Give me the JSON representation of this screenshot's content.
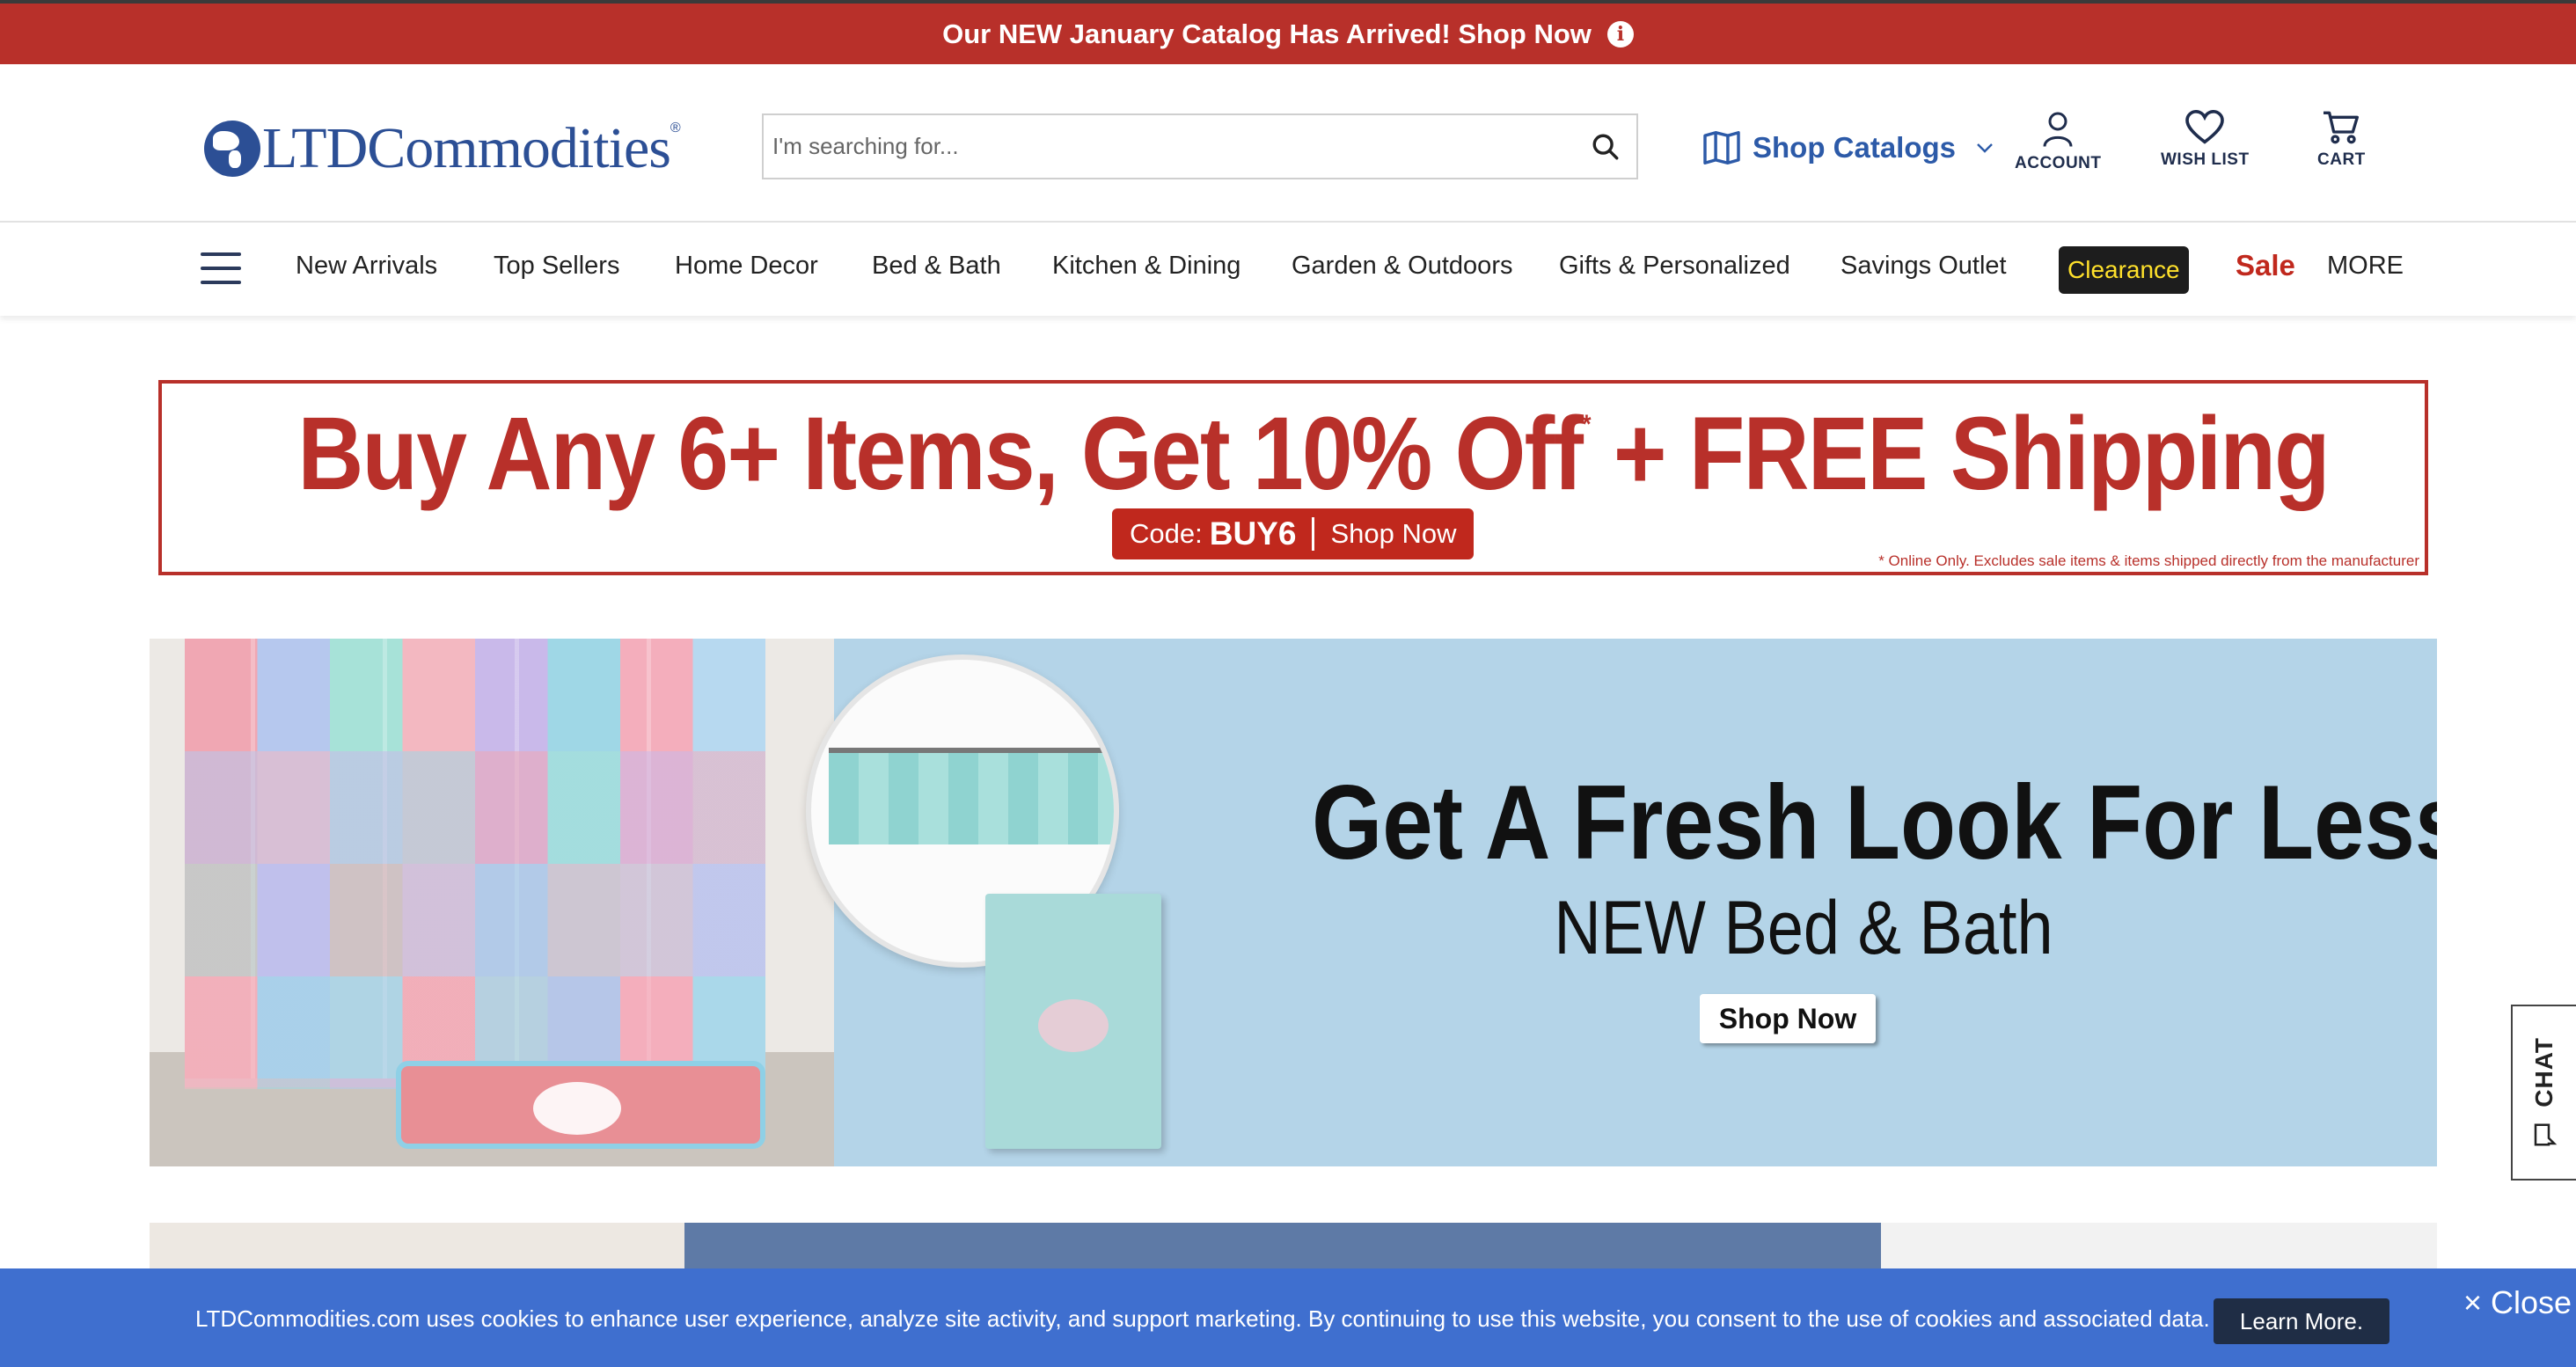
{
  "announcement": {
    "text": "Our NEW January Catalog Has Arrived! Shop Now",
    "icon": "info-icon"
  },
  "header": {
    "logo_text": "LTDCommodities",
    "logo_mark": "®",
    "search": {
      "placeholder": "I'm searching for...",
      "value": ""
    },
    "shop_catalogs_label": "Shop Catalogs",
    "account_label": "ACCOUNT",
    "wishlist_label": "WISH LIST",
    "cart_label": "CART"
  },
  "nav": {
    "items": [
      "New Arrivals",
      "Top Sellers",
      "Home Decor",
      "Bed & Bath",
      "Kitchen & Dining",
      "Garden & Outdoors",
      "Gifts & Personalized",
      "Savings Outlet"
    ],
    "clearance_label": "Clearance",
    "sale_label": "Sale",
    "more_label": "MORE"
  },
  "promo": {
    "headline_part1": "Buy Any 6+ Items, Get 10% Off",
    "asterisk": "*",
    "headline_part2": " + FREE Shipping",
    "code_label": "Code:",
    "code_value": "BUY6",
    "shop_label": "Shop Now",
    "fine_print": "* Online Only. Excludes sale items & items shipped directly from the manufacturer"
  },
  "hero": {
    "title": "Get A Fresh Look For Less!",
    "subtitle": "NEW Bed & Bath",
    "button_label": "Shop Now"
  },
  "chat": {
    "label": "CHAT"
  },
  "cookie": {
    "text": "LTDCommodities.com uses cookies to enhance user experience, analyze site activity, and support marketing. By continuing to use this website, you consent to the use of cookies and associated data.",
    "learn_more_label": "Learn More.",
    "close_label": "× Close"
  },
  "colors": {
    "brand_red": "#b8302a",
    "brand_blue": "#2c4f95",
    "cookie_blue": "#3f6fcf",
    "clearance_yellow": "#ffe12b",
    "hero_blue": "#b4d4e8"
  }
}
